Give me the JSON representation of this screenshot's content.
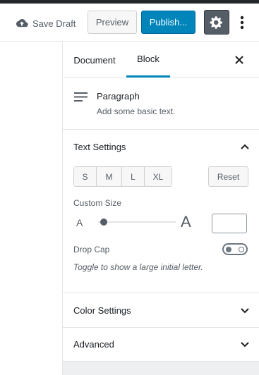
{
  "header": {
    "save_draft": "Save Draft",
    "preview": "Preview",
    "publish": "Publish...",
    "icons": {
      "save": "cloud-upload-icon",
      "settings": "gear-icon",
      "more": "more-vertical-icon"
    },
    "colors": {
      "publish_bg": "#0085ba",
      "settings_bg": "#555d66"
    }
  },
  "sidebar": {
    "tabs": [
      {
        "label": "Document",
        "active": false
      },
      {
        "label": "Block",
        "active": true
      }
    ],
    "close_icon": "close-icon",
    "block": {
      "icon": "paragraph-icon",
      "title": "Paragraph",
      "description": "Add some basic text."
    },
    "text_settings": {
      "title": "Text Settings",
      "expanded": true,
      "sizes": [
        "S",
        "M",
        "L",
        "XL"
      ],
      "reset": "Reset",
      "custom_size_label": "Custom Size",
      "a_small": "A",
      "a_large": "A",
      "custom_size_value": "",
      "drop_cap_label": "Drop Cap",
      "drop_cap_enabled": false,
      "drop_cap_help": "Toggle to show a large initial letter."
    },
    "color_settings": {
      "title": "Color Settings",
      "expanded": false
    },
    "advanced": {
      "title": "Advanced",
      "expanded": false
    }
  }
}
